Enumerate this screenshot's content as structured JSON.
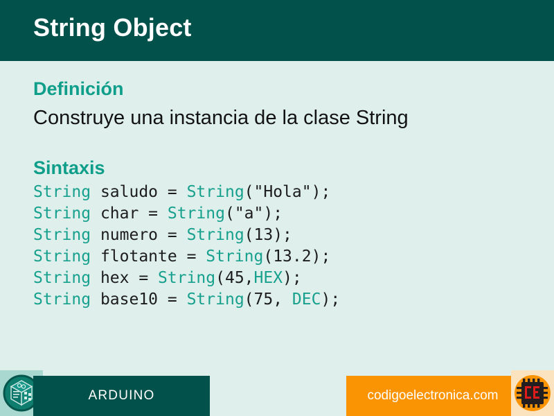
{
  "header": {
    "title": "String Object",
    "background_color": "#02514a",
    "text_color": "#ffffff"
  },
  "theme": {
    "page_background": "#dff0ec",
    "accent_teal": "#0f9e8a",
    "code_keyword": "#16a08d",
    "code_plain": "#1c1c1c",
    "orange": "#fb9403",
    "dark_green": "#02514a"
  },
  "content": {
    "definition_heading": "Definición",
    "definition_text": "Construye una instancia de la clase String",
    "syntax_heading": "Sintaxis",
    "code_lines": [
      [
        {
          "t": "String",
          "c": "kw"
        },
        {
          "t": " saludo = ",
          "c": "plain"
        },
        {
          "t": "String",
          "c": "kw"
        },
        {
          "t": "(\"Hola\");",
          "c": "plain"
        }
      ],
      [
        {
          "t": "String",
          "c": "kw"
        },
        {
          "t": " char = ",
          "c": "plain"
        },
        {
          "t": "String",
          "c": "kw"
        },
        {
          "t": "(\"a\");",
          "c": "plain"
        }
      ],
      [
        {
          "t": "String",
          "c": "kw"
        },
        {
          "t": " numero = ",
          "c": "plain"
        },
        {
          "t": "String",
          "c": "kw"
        },
        {
          "t": "(13);",
          "c": "plain"
        }
      ],
      [
        {
          "t": "String",
          "c": "kw"
        },
        {
          "t": " flotante = ",
          "c": "plain"
        },
        {
          "t": "String",
          "c": "kw"
        },
        {
          "t": "(13.2);",
          "c": "plain"
        }
      ],
      [
        {
          "t": "String",
          "c": "kw"
        },
        {
          "t": " hex = ",
          "c": "plain"
        },
        {
          "t": "String",
          "c": "kw"
        },
        {
          "t": "(45,",
          "c": "plain"
        },
        {
          "t": "HEX",
          "c": "kw"
        },
        {
          "t": ");",
          "c": "plain"
        }
      ],
      [
        {
          "t": "String",
          "c": "kw"
        },
        {
          "t": " base10 = ",
          "c": "plain"
        },
        {
          "t": "String",
          "c": "kw"
        },
        {
          "t": "(75, ",
          "c": "plain"
        },
        {
          "t": "DEC",
          "c": "kw"
        },
        {
          "t": ");",
          "c": "plain"
        }
      ]
    ]
  },
  "footer": {
    "left_label": "ARDUINO",
    "left_logo_icon": "arduino-cube-logo-icon",
    "right_label": "codigoelectronica.com",
    "right_logo_icon": "codigoelectronica-chip-logo-icon"
  }
}
